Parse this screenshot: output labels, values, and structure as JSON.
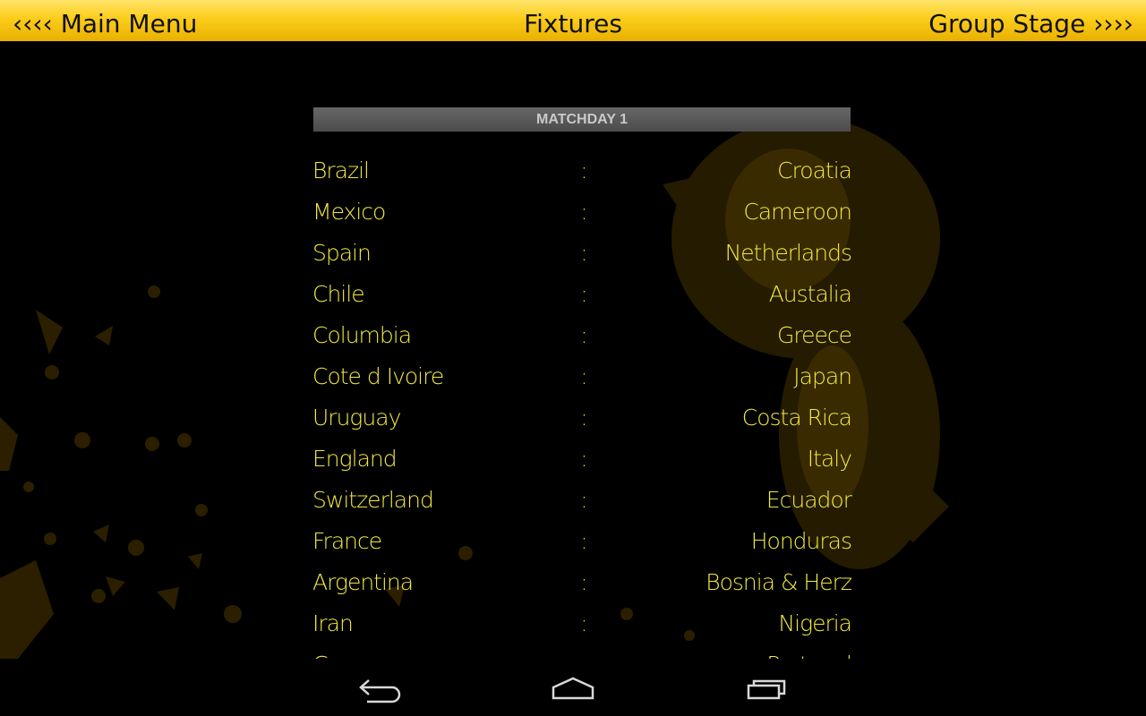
{
  "topbar": {
    "left_nav": "‹‹‹‹ Main Menu",
    "title": "Fixtures",
    "right_nav": "Group Stage ››››"
  },
  "matchday": {
    "label": "MATCHDAY 1"
  },
  "fixtures": [
    {
      "home": "Brazil",
      "sep": ":",
      "away": "Croatia"
    },
    {
      "home": "Mexico",
      "sep": ":",
      "away": "Cameroon"
    },
    {
      "home": "Spain",
      "sep": ":",
      "away": "Netherlands"
    },
    {
      "home": "Chile",
      "sep": ":",
      "away": "Austalia"
    },
    {
      "home": "Columbia",
      "sep": ":",
      "away": "Greece"
    },
    {
      "home": "Cote d Ivoire",
      "sep": ":",
      "away": "Japan"
    },
    {
      "home": "Uruguay",
      "sep": ":",
      "away": "Costa Rica"
    },
    {
      "home": "England",
      "sep": ":",
      "away": "Italy"
    },
    {
      "home": "Switzerland",
      "sep": ":",
      "away": "Ecuador"
    },
    {
      "home": "France",
      "sep": ":",
      "away": "Honduras"
    },
    {
      "home": "Argentina",
      "sep": ":",
      "away": "Bosnia & Herz"
    },
    {
      "home": "Iran",
      "sep": ":",
      "away": "Nigeria"
    },
    {
      "home": "G",
      "sep": ":",
      "away": "Portugal"
    }
  ],
  "system_nav": {
    "back_icon": "back-arrow-icon",
    "home_icon": "home-icon",
    "recent_icon": "recent-apps-icon"
  },
  "colors": {
    "topbar": "#fbcd1a",
    "fixture_text": "#f2e93e",
    "background": "#000000"
  }
}
